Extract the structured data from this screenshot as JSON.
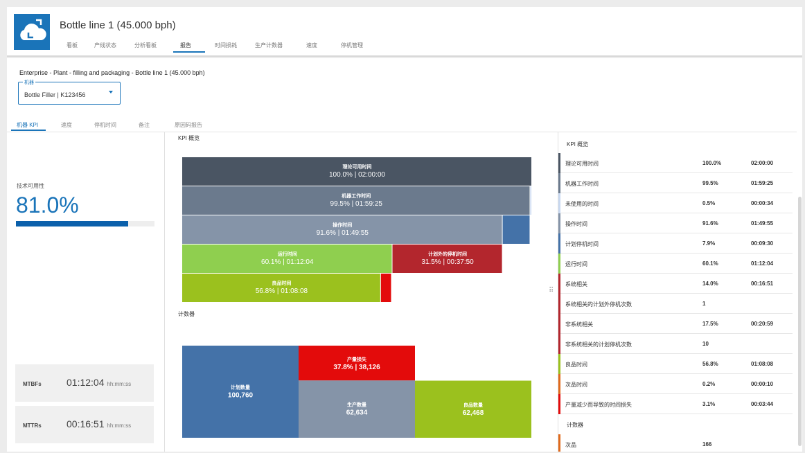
{
  "header": {
    "title": "Bottle line 1 (45.000 bph)",
    "tabs": [
      {
        "label": "看板",
        "active": false
      },
      {
        "label": "产线状态",
        "active": false
      },
      {
        "label": "分析看板",
        "active": false
      },
      {
        "label": "报告",
        "active": true
      },
      {
        "label": "时间损耗",
        "active": false
      },
      {
        "label": "生产计数器",
        "active": false
      },
      {
        "label": "速度",
        "active": false
      },
      {
        "label": "停机管理",
        "active": false
      }
    ]
  },
  "breadcrumb": "Enterprise - Plant - filling and packaging - Bottle line 1 (45.000 bph)",
  "machine": {
    "label": "机器",
    "value": "Bottle Filler | K123456"
  },
  "subtabs": [
    {
      "label": "机器 KPI",
      "active": true
    },
    {
      "label": "速度",
      "active": false
    },
    {
      "label": "停机时间",
      "active": false
    },
    {
      "label": "备注",
      "active": false
    },
    {
      "label": "原因码报告",
      "active": false
    }
  ],
  "left": {
    "availability_label": "技术可用性",
    "availability_value": "81.0%",
    "availability_fraction": 0.81,
    "mtbf": {
      "name": "MTBFs",
      "value": "01:12:04",
      "unit": "hh:mm:ss"
    },
    "mttr": {
      "name": "MTTRs",
      "value": "00:16:51",
      "unit": "hh:mm:ss"
    }
  },
  "colors": {
    "accent": "#1a74b9",
    "dark": "#4a5563",
    "slate": "#6b7a8d",
    "grayblue": "#8594a8",
    "blue": "#4472a8",
    "green": "#8fcf4f",
    "darkgreen": "#9bc11e",
    "darkred": "#b3262d",
    "red": "#e30b0b",
    "orange": "#e06a1c",
    "lightblue": "#c8d8f0"
  },
  "kpi_title": "KPI 概览",
  "counter_title": "计数器",
  "chart_data": [
    {
      "type": "bar",
      "title": "KPI 概览",
      "rows": [
        [
          {
            "label": "理论可用时间",
            "value": "100.0% | 02:00:00",
            "percent": 100.0,
            "color": "dark"
          }
        ],
        [
          {
            "label": "机器工作时间",
            "value": "99.5% | 01:59:25",
            "percent": 99.5,
            "color": "slate"
          },
          {
            "label": "",
            "value": "",
            "percent": 0.5,
            "color": "lightblue"
          }
        ],
        [
          {
            "label": "操作时间",
            "value": "91.6% | 01:49:55",
            "percent": 91.6,
            "color": "grayblue"
          },
          {
            "label": "",
            "value": "",
            "percent": 7.9,
            "color": "blue"
          }
        ],
        [
          {
            "label": "运行时间",
            "value": "60.1% | 01:12:04",
            "percent": 60.1,
            "color": "green"
          },
          {
            "label": "计划外的停机时间",
            "value": "31.5% | 00:37:50",
            "percent": 31.5,
            "color": "darkred"
          }
        ],
        [
          {
            "label": "良品时间",
            "value": "56.8% | 01:08:08",
            "percent": 56.8,
            "color": "darkgreen"
          },
          {
            "label": "",
            "value": "",
            "percent": 3.1,
            "color": "red"
          }
        ]
      ]
    },
    {
      "type": "bar",
      "title": "计数器",
      "blocks": [
        {
          "label": "计划数量",
          "value": "100,760",
          "count": 100760,
          "color": "blue"
        },
        {
          "label": "产量损失",
          "value": "37.8% | 38,126",
          "count": 38126,
          "color": "red"
        },
        {
          "label": "生产数量",
          "value": "62,634",
          "count": 62634,
          "color": "grayblue"
        },
        {
          "label": "良品数量",
          "value": "62,468",
          "count": 62468,
          "color": "darkgreen"
        }
      ]
    }
  ],
  "table": {
    "title": "KPI 概览",
    "rows": [
      {
        "name": "理论可用时间",
        "pct": "100.0%",
        "time": "02:00:00",
        "color": "dark"
      },
      {
        "name": "机器工作时间",
        "pct": "99.5%",
        "time": "01:59:25",
        "color": "slate"
      },
      {
        "name": "未使用的时间",
        "pct": "0.5%",
        "time": "00:00:34",
        "color": "lightblue"
      },
      {
        "name": "操作时间",
        "pct": "91.6%",
        "time": "01:49:55",
        "color": "grayblue"
      },
      {
        "name": "计划停机时间",
        "pct": "7.9%",
        "time": "00:09:30",
        "color": "blue"
      },
      {
        "name": "运行时间",
        "pct": "60.1%",
        "time": "01:12:04",
        "color": "green"
      },
      {
        "name": "系统相关",
        "pct": "14.0%",
        "time": "00:16:51",
        "color": "darkred"
      },
      {
        "name": "系统相关的计划外停机次数",
        "pct": "1",
        "time": "",
        "color": "darkred"
      },
      {
        "name": "非系统相关",
        "pct": "17.5%",
        "time": "00:20:59",
        "color": "darkred"
      },
      {
        "name": "非系统相关的计划停机次数",
        "pct": "10",
        "time": "",
        "color": "darkred"
      },
      {
        "name": "良品时间",
        "pct": "56.8%",
        "time": "01:08:08",
        "color": "darkgreen"
      },
      {
        "name": "次品时间",
        "pct": "0.2%",
        "time": "00:00:10",
        "color": "orange"
      },
      {
        "name": "产量减少而导致的时间损失",
        "pct": "3.1%",
        "time": "00:03:44",
        "color": "red"
      }
    ],
    "counter_title": "计数器",
    "counter_rows": [
      {
        "name": "次品",
        "pct": "166",
        "time": "",
        "color": "orange"
      }
    ]
  }
}
